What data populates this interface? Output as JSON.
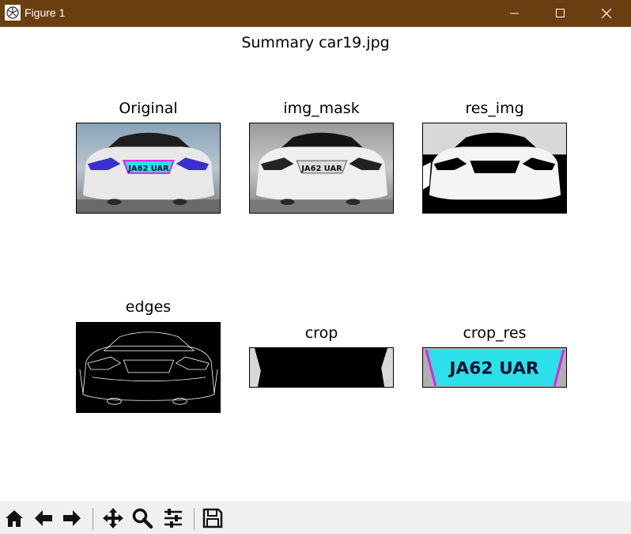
{
  "window": {
    "title": "Figure 1",
    "controls": [
      "minimize",
      "maximize",
      "close"
    ]
  },
  "figure": {
    "suptitle": "Summary car19.jpg",
    "plate_text": "JA62 UAR",
    "panels": [
      {
        "id": "original",
        "title": "Original"
      },
      {
        "id": "img_mask",
        "title": "img_mask"
      },
      {
        "id": "res_img",
        "title": "res_img"
      },
      {
        "id": "edges",
        "title": "edges"
      },
      {
        "id": "crop",
        "title": "crop"
      },
      {
        "id": "crop_res",
        "title": "crop_res"
      }
    ]
  },
  "toolbar": {
    "buttons": [
      "home-icon",
      "back-icon",
      "forward-icon",
      "pan-icon",
      "zoom-icon",
      "configure-subplots-icon",
      "save-icon"
    ]
  },
  "colors": {
    "titlebar": "#6b3e10",
    "toolbar": "#f0f0f0",
    "plate_highlight": "#2be0e8",
    "plate_outline": "#e020e0"
  }
}
